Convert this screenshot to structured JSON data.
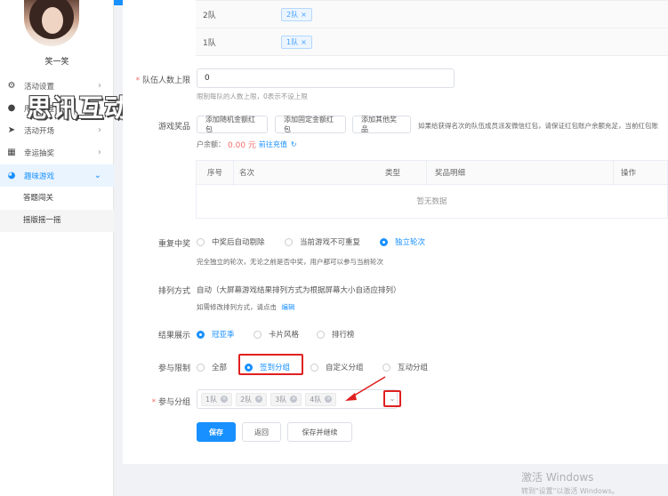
{
  "sidebar": {
    "username": "笑一笑",
    "items": [
      {
        "label": "活动设置",
        "icon": "gear-icon"
      },
      {
        "label": "用户管理",
        "icon": "user-icon"
      },
      {
        "label": "活动开场",
        "icon": "send-icon"
      },
      {
        "label": "幸运抽奖",
        "icon": "gift-icon"
      },
      {
        "label": "趣味游戏",
        "icon": "game-icon"
      }
    ],
    "sub_items": [
      "答题闯关",
      "摇版摇一摇"
    ],
    "watermark": "思讯互动"
  },
  "groups": {
    "rows": [
      {
        "name": "2队",
        "tag": "2队"
      },
      {
        "name": "1队",
        "tag": "1队"
      }
    ]
  },
  "team_limit": {
    "label": "队伍人数上限",
    "value": "0",
    "hint": "限制每队的人数上限，0表示不设上限"
  },
  "prizes": {
    "label": "游戏奖品",
    "buttons": [
      "添加随机金额红包",
      "添加固定金额红包",
      "添加其他奖品"
    ],
    "note": "如果给获得名次的队伍成员派发微信红包，请保证红包账户余额充足，当前红包账",
    "balance_label": "户余额：",
    "balance_value": "0.00 元",
    "recharge_link": "前往充值",
    "refresh_icon": "refresh-icon",
    "table_headers": [
      "序号",
      "名次",
      "类型",
      "奖品明细",
      "操作"
    ],
    "empty_text": "暂无数据"
  },
  "repeat_win": {
    "label": "重复中奖",
    "options": [
      "中奖后自动剔除",
      "当前游戏不可重复",
      "独立轮次"
    ],
    "selected": 2,
    "hint": "完全独立的轮次，无论之前是否中奖，用户都可以参与当前轮次"
  },
  "ranking": {
    "label": "排列方式",
    "value": "自动（大屏幕游戏结果排列方式为根据屏幕大小自适应排列）",
    "hint": "如需修改排列方式，请点击",
    "edit_link": "编辑"
  },
  "result_display": {
    "label": "结果展示",
    "options": [
      "冠亚季",
      "卡片风格",
      "排行榜"
    ],
    "selected": 0
  },
  "participation": {
    "label": "参与限制",
    "options": [
      "全部",
      "签到分组",
      "自定义分组",
      "互动分组"
    ],
    "selected": 1
  },
  "join_groups": {
    "label": "参与分组",
    "tags": [
      "1队",
      "2队",
      "3队",
      "4队"
    ]
  },
  "actions": {
    "save": "保存",
    "back": "返回",
    "save_continue": "保存并继续"
  },
  "windows_watermark": {
    "line1": "激活 Windows",
    "line2": "转到\"设置\"以激活 Windows。"
  },
  "colors": {
    "primary": "#1890ff",
    "highlight": "#e02020",
    "price": "#f56c6c"
  }
}
